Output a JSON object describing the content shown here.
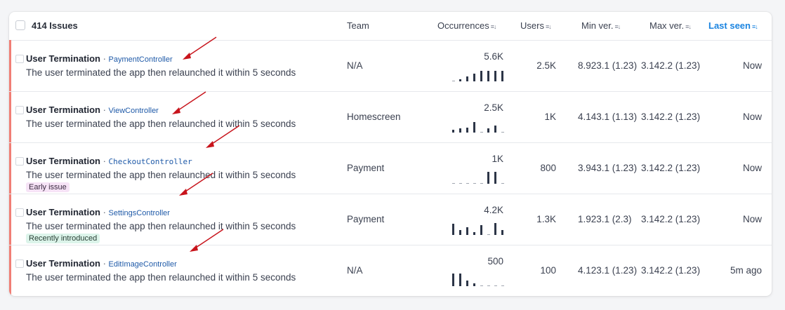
{
  "header": {
    "issue_count": "414 Issues",
    "columns": {
      "team": "Team",
      "occurrences": "Occurrences",
      "users": "Users",
      "min_ver": "Min ver.",
      "max_ver": "Max ver.",
      "last_seen": "Last seen"
    },
    "sort_icon": "sort-icon",
    "active_sort_color": "#1b84e0"
  },
  "accent_bar_color": "#f07e75",
  "rows": [
    {
      "title": "User Termination",
      "controller": "PaymentController",
      "description": "The user terminated the app then relaunched it within 5 seconds",
      "badge": "",
      "team": "N/A",
      "occurrences": "5.6K",
      "sparkline": [
        0,
        0.15,
        0.35,
        0.55,
        0.75,
        0.75,
        0.75,
        0.75
      ],
      "users": "2.5K",
      "min_ver": "8.923.1 (1.23)",
      "max_ver": "3.142.2 (1.23)",
      "last_seen": "Now"
    },
    {
      "title": "User Termination",
      "controller": "ViewController",
      "description": "The user terminated the app then relaunched it within 5 seconds",
      "badge": "",
      "team": "Homescreen",
      "occurrences": "2.5K",
      "sparkline": [
        0.2,
        0.3,
        0.35,
        0.75,
        0,
        0.3,
        0.5,
        0
      ],
      "users": "1K",
      "min_ver": "4.143.1 (1.13)",
      "max_ver": "3.142.2 (1.23)",
      "last_seen": "Now"
    },
    {
      "title": "User Termination",
      "controller": "CheckoutController",
      "description": "The user terminated the app then relaunched it within 5 seconds",
      "badge": "Early issue",
      "team": "Payment",
      "occurrences": "1K",
      "sparkline": [
        0,
        0,
        0,
        0,
        0,
        0.85,
        0.85,
        0
      ],
      "users": "800",
      "min_ver": "3.943.1 (1.23)",
      "max_ver": "3.142.2 (1.23)",
      "last_seen": "Now"
    },
    {
      "title": "User Termination",
      "controller": "SettingsController",
      "description": "The user terminated the app then relaunched it within 5 seconds",
      "badge": "Recently introduced",
      "team": "Payment",
      "occurrences": "4.2K",
      "sparkline": [
        0.8,
        0.35,
        0.55,
        0.2,
        0.7,
        0,
        0.85,
        0.35
      ],
      "users": "1.3K",
      "min_ver": "1.923.1 (2.3)",
      "max_ver": "3.142.2 (1.23)",
      "last_seen": "Now"
    },
    {
      "title": "User Termination",
      "controller": "EditImageController",
      "description": "The user terminated the app then relaunched it within 5 seconds",
      "badge": "",
      "team": "N/A",
      "occurrences": "500",
      "sparkline": [
        0.9,
        0.9,
        0.4,
        0.2,
        0,
        0,
        0,
        0
      ],
      "users": "100",
      "min_ver": "4.123.1 (1.23)",
      "max_ver": "3.142.2 (1.23)",
      "last_seen": "5m ago"
    }
  ]
}
